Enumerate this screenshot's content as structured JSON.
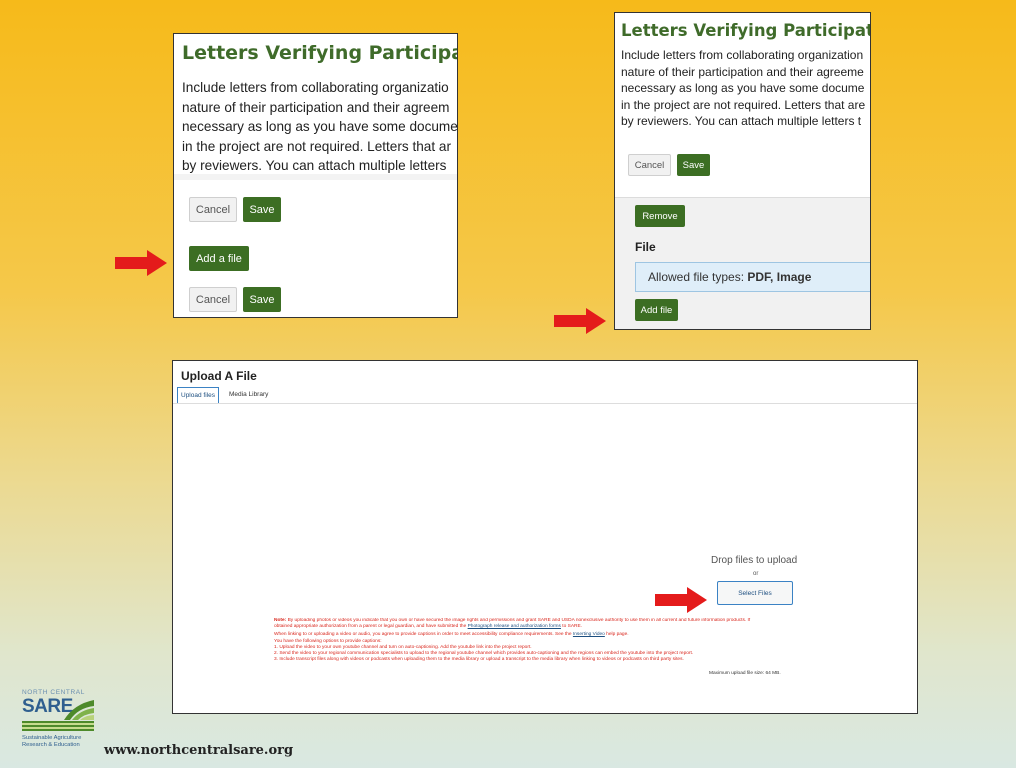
{
  "panel1": {
    "title": "Letters Verifying Participation",
    "lines": [
      "Include letters from collaborating organizatio",
      "nature of their participation and their agreem",
      "necessary as long as you have some docume",
      "in the project are not required. Letters that ar",
      "by reviewers. You can attach multiple letters"
    ],
    "cancel_label": "Cancel",
    "save_label": "Save",
    "add_file_label": "Add a file",
    "cancel2_label": "Cancel",
    "save2_label": "Save"
  },
  "panel2": {
    "title": "Letters Verifying Participation",
    "lines": [
      "Include letters from collaborating organization",
      "nature of their participation and their agreeme",
      "necessary as long as you have some docume",
      "in the project are not required. Letters that are",
      "by reviewers. You can attach multiple letters t"
    ],
    "cancel_label": "Cancel",
    "save_label": "Save",
    "remove_label": "Remove",
    "file_label": "File",
    "allowed_prefix": "Allowed file types: ",
    "allowed_types": "PDF, Image",
    "add_file_label": "Add file"
  },
  "panel3": {
    "title": "Upload A File",
    "tabs": [
      "Upload files",
      "Media Library"
    ],
    "drop_text": "Drop files to upload",
    "or_text": "or",
    "select_label": "Select Files",
    "note_label": "Note:",
    "note_line1": " By uploading photos or videos you indicate that you own or have secured the image rights and permissions and grant SARE and USDA nonexclusive authority to use them in all current and future information products. If",
    "note_line2_a": "obtained appropriate authorization from a parent or legal guardian, and have submitted the ",
    "note_line2_link": "Photograph release and authorization forms",
    "note_line2_b": " to SARE.",
    "captions_line_a": "When linking to or uploading a video or audio, you agree to provide captions in order to meet accessibility compliance requirements. See the ",
    "captions_link": "Inserting Video",
    "captions_line_b": " help page.",
    "options_intro": "You have the following options to provide captions:",
    "options": [
      "1. Upload the video to your own youtube channel and turn on auto-captioning. Add the youtube link into the project report.",
      "2. Send the video to your regional communication specialists to upload to the regional youtube channel which provides auto-captioning and the regions can embed the youtube into the project report.",
      "3. Include transcript files along with videos or podcasts when uploading them to the media library or upload a transcript to the media library when linking to videos or podcasts on third party sites."
    ],
    "max_size": "Maximum upload file size: 64 MB."
  },
  "logo": {
    "top_text": "NORTH CENTRAL",
    "brand": "SARE",
    "sub1": "Sustainable Agriculture",
    "sub2": "Research & Education"
  },
  "footer_url": "www.northcentralsare.org",
  "colors": {
    "green": "#3c6e23",
    "heading_green": "#3f6b2a",
    "arrow_red": "#e41b1b",
    "note_red": "#d9261c"
  },
  "icons": [
    "red-arrow-icon",
    "sare-logo-icon"
  ]
}
